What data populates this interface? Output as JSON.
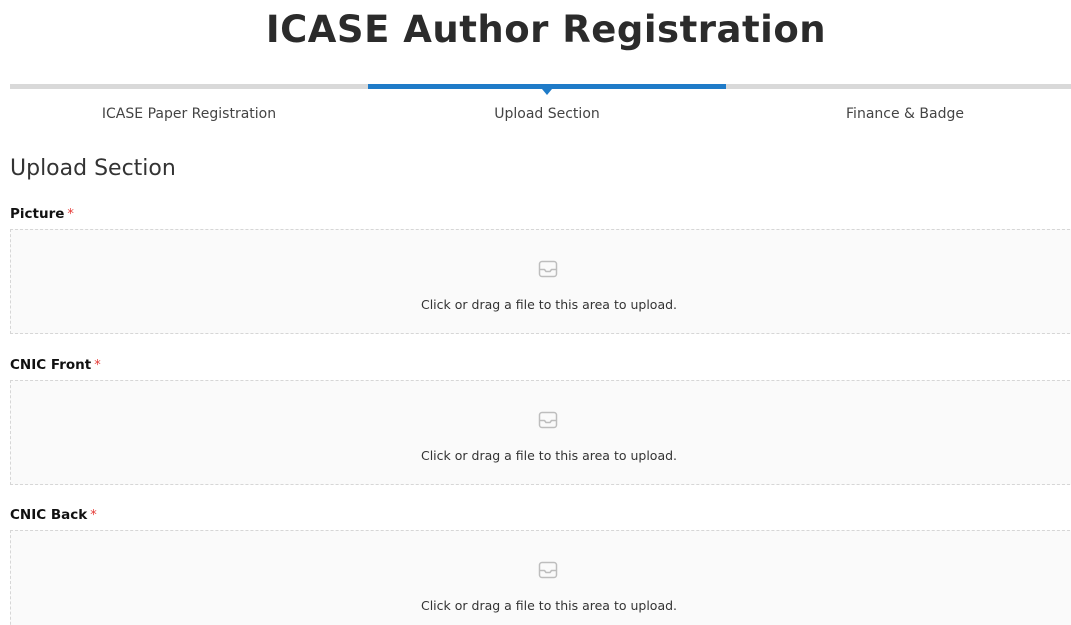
{
  "page": {
    "title": "ICASE Author Registration"
  },
  "steps": [
    {
      "label": "ICASE Paper Registration",
      "active": false
    },
    {
      "label": "Upload Section",
      "active": true
    },
    {
      "label": "Finance & Badge",
      "active": false
    }
  ],
  "section": {
    "heading": "Upload Section"
  },
  "fields": [
    {
      "label": "Picture",
      "required_mark": "*",
      "hint": "Click or drag a file to this area to upload.",
      "icon": "inbox-icon"
    },
    {
      "label": "CNIC Front",
      "required_mark": "*",
      "hint": "Click or drag a file to this area to upload.",
      "icon": "inbox-icon"
    },
    {
      "label": "CNIC Back",
      "required_mark": "*",
      "hint": "Click or drag a file to this area to upload.",
      "icon": "inbox-icon"
    }
  ],
  "colors": {
    "accent": "#1f7bc8",
    "required": "#e53935",
    "step_inactive": "#d9d9d9",
    "dropzone_bg": "#fafafa"
  }
}
